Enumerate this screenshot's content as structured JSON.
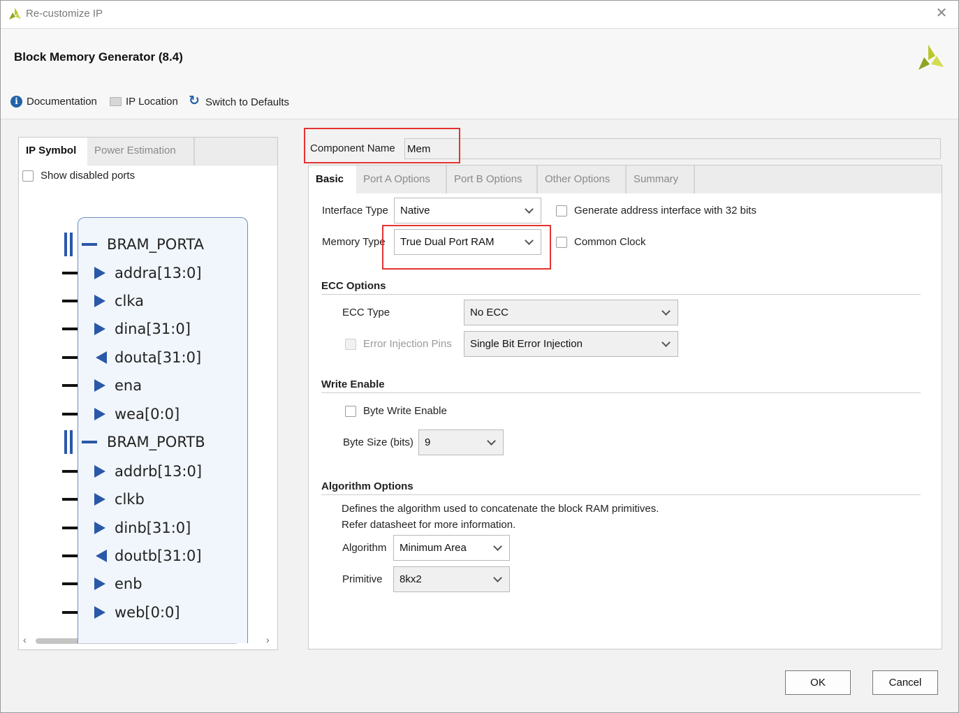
{
  "window": {
    "title": "Re-customize IP",
    "close_icon": "close-icon"
  },
  "header": {
    "title": "Block Memory Generator (8.4)",
    "logo": "xilinx-logo"
  },
  "toolbar": {
    "documentation": "Documentation",
    "ip_location": "IP Location",
    "switch_defaults": "Switch to Defaults"
  },
  "left_panel": {
    "tabs": [
      "IP Symbol",
      "Power Estimation"
    ],
    "active_tab": "IP Symbol",
    "show_disabled_ports": "Show disabled ports",
    "show_disabled_ports_checked": false,
    "buses": [
      {
        "name": "BRAM_PORTA",
        "ports": [
          {
            "label": "addra[13:0]",
            "dir": "in"
          },
          {
            "label": "clka",
            "dir": "in"
          },
          {
            "label": "dina[31:0]",
            "dir": "in"
          },
          {
            "label": "douta[31:0]",
            "dir": "out"
          },
          {
            "label": "ena",
            "dir": "in"
          },
          {
            "label": "wea[0:0]",
            "dir": "in"
          }
        ]
      },
      {
        "name": "BRAM_PORTB",
        "ports": [
          {
            "label": "addrb[13:0]",
            "dir": "in"
          },
          {
            "label": "clkb",
            "dir": "in"
          },
          {
            "label": "dinb[31:0]",
            "dir": "in"
          },
          {
            "label": "doutb[31:0]",
            "dir": "out"
          },
          {
            "label": "enb",
            "dir": "in"
          },
          {
            "label": "web[0:0]",
            "dir": "in"
          }
        ]
      }
    ]
  },
  "component": {
    "label": "Component Name",
    "value": "Mem"
  },
  "right_tabs": [
    "Basic",
    "Port A Options",
    "Port B Options",
    "Other Options",
    "Summary"
  ],
  "active_right_tab": "Basic",
  "basic": {
    "interface_type_label": "Interface Type",
    "interface_type_value": "Native",
    "generate_address_label": "Generate address interface with 32 bits",
    "memory_type_label": "Memory Type",
    "memory_type_value": "True Dual Port RAM",
    "common_clock_label": "Common Clock",
    "ecc_section": "ECC Options",
    "ecc_type_label": "ECC Type",
    "ecc_type_value": "No ECC",
    "error_injection_label": "Error Injection Pins",
    "error_injection_value": "Single Bit Error Injection",
    "write_enable_section": "Write Enable",
    "byte_write_enable_label": "Byte Write Enable",
    "byte_size_label": "Byte Size (bits)",
    "byte_size_value": "9",
    "algorithm_section": "Algorithm Options",
    "algorithm_desc_1": "Defines the algorithm used to concatenate the block RAM primitives.",
    "algorithm_desc_2": "Refer datasheet for more information.",
    "algorithm_label": "Algorithm",
    "algorithm_value": "Minimum Area",
    "primitive_label": "Primitive",
    "primitive_value": "8kx2"
  },
  "footer": {
    "ok": "OK",
    "cancel": "Cancel"
  },
  "colors": {
    "accent_blue": "#2a58a8",
    "highlight_red": "#e53232",
    "symbol_fill": "#f1f6fc"
  }
}
